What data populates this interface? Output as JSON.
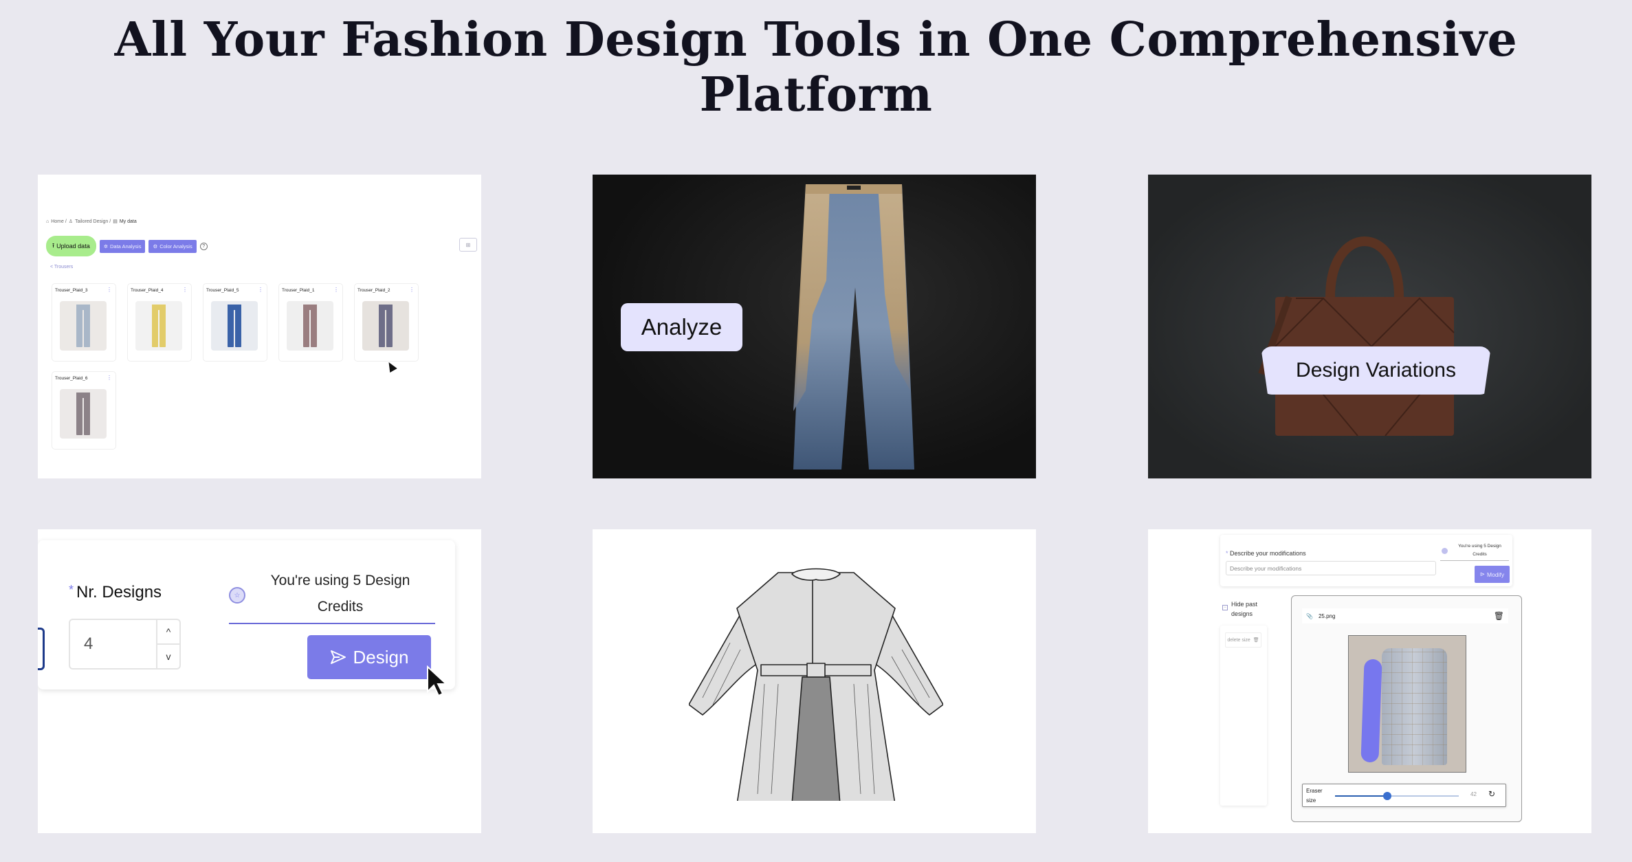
{
  "page": {
    "title": "All Your Fashion Design Tools in One Comprehensive Platform",
    "background": "#e9e8ef",
    "accent": "#7b7be8"
  },
  "upload_card": {
    "breadcrumb": [
      {
        "icon": "home-icon",
        "label": "Home /"
      },
      {
        "icon": "design-icon",
        "label": "Tailored Design /"
      },
      {
        "icon": "data-icon",
        "label": "My data"
      }
    ],
    "buttons": {
      "upload": "Upload data",
      "data_analysis": "Data Analysis",
      "color_analysis": "Color Analysis",
      "help": "?",
      "grid_view": "⊞"
    },
    "back_link": "< Trousers",
    "items": [
      {
        "name": "Trouser_Plaid_3",
        "color": "#a9b7c8",
        "bg": "#ece9e6"
      },
      {
        "name": "Trouser_Plaid_4",
        "color": "#e2cc6a",
        "bg": "#f2f2f2"
      },
      {
        "name": "Trouser_Plaid_5",
        "color": "#3a62a8",
        "bg": "#e8ebf0"
      },
      {
        "name": "Trouser_Plaid_1",
        "color": "#9a7e80",
        "bg": "#efefef"
      },
      {
        "name": "Trouser_Plaid_2",
        "color": "#6e6e88",
        "bg": "#e6e2de"
      },
      {
        "name": "Trouser_Plaid_6",
        "color": "#8c8288",
        "bg": "#ece9e8"
      }
    ],
    "item_menu": "⋮"
  },
  "analyze_card": {
    "label": "Analyze"
  },
  "variations_card": {
    "label": "Design Variations"
  },
  "design_card": {
    "field_label": "Nr. Designs",
    "required_mark": "*",
    "value": "4",
    "step_up": "^",
    "step_down": "v",
    "credits_text": "You're using 5 Design Credits",
    "button_label": "Design"
  },
  "sketch_card": {
    "description": "Technical flat sketch of a long coat"
  },
  "modify_card": {
    "field_label": "Describe your modifications",
    "required_mark": "*",
    "placeholder": "Describe your modifications",
    "credits_text": "You're using 5 Design Credits",
    "button_label": "Modify",
    "hide_past_label": "Hide past designs",
    "hide_past_box": "−",
    "delete_size_label": "delete size",
    "file_name": "25.png",
    "eraser_label": "Eraser size",
    "eraser_value": "42",
    "eraser_fraction": 0.42,
    "mask_color": "#7777ee"
  }
}
